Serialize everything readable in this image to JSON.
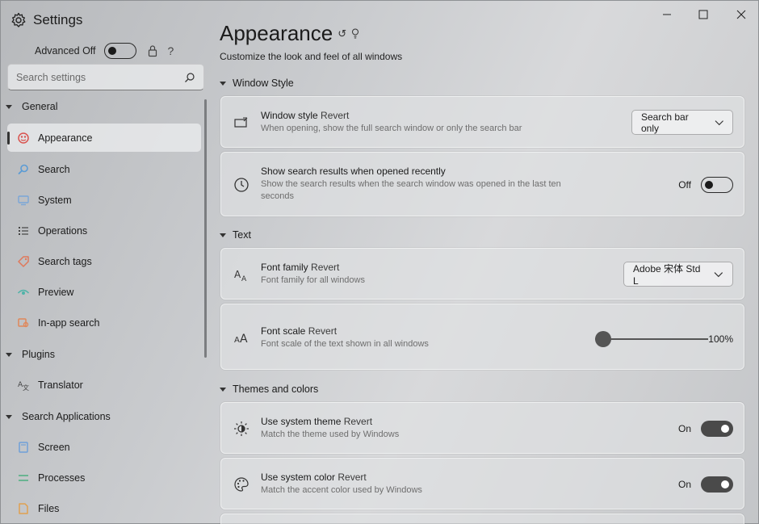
{
  "app": {
    "title": "Settings"
  },
  "advanced": {
    "label": "Advanced Off",
    "state": "off"
  },
  "search": {
    "placeholder": "Search settings"
  },
  "nav": {
    "general": {
      "label": "General"
    },
    "appearance": {
      "label": "Appearance",
      "icon": "appearance-icon",
      "color": "#d9534f"
    },
    "search": {
      "label": "Search",
      "icon": "magnifier-icon",
      "color": "#5a9bd5"
    },
    "system": {
      "label": "System",
      "icon": "monitor-icon",
      "color": "#7aa6d8"
    },
    "operations": {
      "label": "Operations",
      "icon": "list-icon",
      "color": "#444444"
    },
    "search_tags": {
      "label": "Search tags",
      "icon": "tag-icon",
      "color": "#e0785a"
    },
    "preview": {
      "label": "Preview",
      "icon": "eye-icon",
      "color": "#4fb3a8"
    },
    "inapp": {
      "label": "In-app search",
      "icon": "inapp-icon",
      "color": "#e0875a"
    },
    "plugins": {
      "label": "Plugins"
    },
    "translator": {
      "label": "Translator",
      "icon": "translator-icon",
      "color": "#444444"
    },
    "search_apps": {
      "label": "Search Applications"
    },
    "screen": {
      "label": "Screen",
      "icon": "screen-icon",
      "color": "#6fa0d8"
    },
    "processes": {
      "label": "Processes",
      "icon": "processes-icon",
      "color": "#4caf80"
    },
    "files": {
      "label": "Files",
      "icon": "files-icon",
      "color": "#e0a050"
    }
  },
  "page": {
    "title": "Appearance",
    "subtitle": "Customize the look and feel of all windows"
  },
  "sections": {
    "window_style": "Window Style",
    "text": "Text",
    "themes": "Themes and colors"
  },
  "settings": {
    "window_style": {
      "title": "Window style",
      "revert": "Revert",
      "desc": "When opening, show the full search window or only the search bar",
      "value": "Search bar only"
    },
    "show_recent": {
      "title": "Show search results when opened recently",
      "desc_line1": "Show the search results when the search window was opened in the last ten",
      "desc_line2": "seconds",
      "state": "Off"
    },
    "font_family": {
      "title": "Font family",
      "revert": "Revert",
      "desc": "Font family for all windows",
      "value": "Adobe 宋体 Std L"
    },
    "font_scale": {
      "title": "Font scale",
      "revert": "Revert",
      "desc": "Font scale of the text shown in all windows",
      "value_label": "100%",
      "value_fraction": 0.0
    },
    "system_theme": {
      "title": "Use system theme",
      "revert": "Revert",
      "desc": "Match the theme used by Windows",
      "state": "On"
    },
    "system_color": {
      "title": "Use system color",
      "revert": "Revert",
      "desc": "Match the accent color used by Windows",
      "state": "On"
    }
  }
}
